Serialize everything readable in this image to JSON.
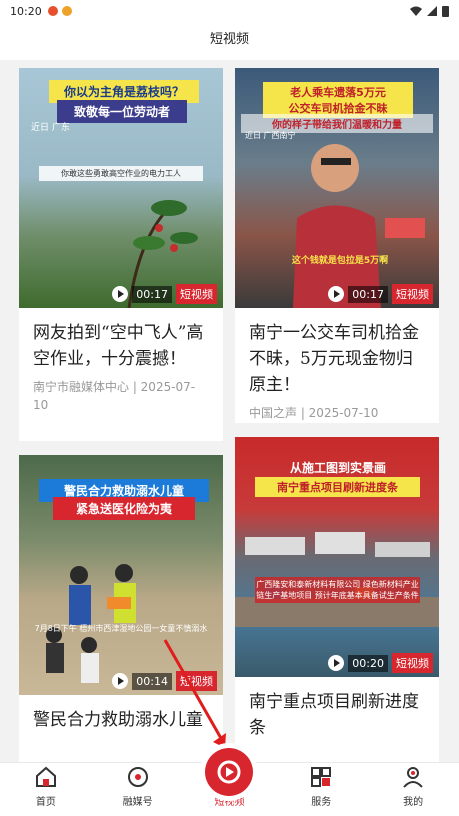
{
  "status": {
    "time": "10:20"
  },
  "header": {
    "title": "短视频"
  },
  "cards": [
    {
      "thumb_title_1": "你以为主角是荔枝吗？",
      "thumb_title_2": "致敬每一位劳动者",
      "thumb_location": "近日 广东",
      "thumb_subtitle": "你敢这些勇敢高空作业的电力工人",
      "duration": "00:17",
      "badge": "短视频",
      "title": "网友拍到“空中飞人”高空作业，十分震撼！",
      "meta": "南宁市融媒体中心 | 2025-07-10"
    },
    {
      "thumb_title_1": "老人乘车遗落5万元",
      "thumb_title_2": "公交车司机拾金不昧",
      "thumb_title_3": "你的样子带给我们温暖和力量",
      "thumb_location": "近日 广西南宁",
      "thumb_subtitle": "这个钱就是包拉是5万啊",
      "duration": "00:17",
      "badge": "短视频",
      "title": "南宁一公交车司机拾金不昧，5万元现金物归原主！",
      "meta": "中国之声 | 2025-07-10"
    },
    {
      "thumb_title_1": "警民合力救助溺水儿童",
      "thumb_title_2": "紧急送医化险为夷",
      "thumb_subtitle": "7月8日下午 梧州市西津湿地公园一女童不慎溺水",
      "duration": "00:14",
      "badge": "短视频",
      "title": "警民合力救助溺水儿童"
    },
    {
      "thumb_title_1": "从施工图到实景画",
      "thumb_title_2": "南宁重点项目刷新进度条",
      "thumb_subtitle": "广西隆安和泰新材料有限公司 绿色新材料产业链生产基地项目 预计年底基本具备试生产条件",
      "duration": "00:20",
      "badge": "短视频",
      "title": "南宁重点项目刷新进度条"
    }
  ],
  "tabs": [
    {
      "label": "首页",
      "icon": "home-icon"
    },
    {
      "label": "融媒号",
      "icon": "media-account-icon"
    },
    {
      "label": "短视频",
      "icon": "short-video-icon",
      "active": true
    },
    {
      "label": "服务",
      "icon": "service-grid-icon"
    },
    {
      "label": "我的",
      "icon": "profile-icon"
    }
  ],
  "colors": {
    "accent": "#d8262f"
  }
}
